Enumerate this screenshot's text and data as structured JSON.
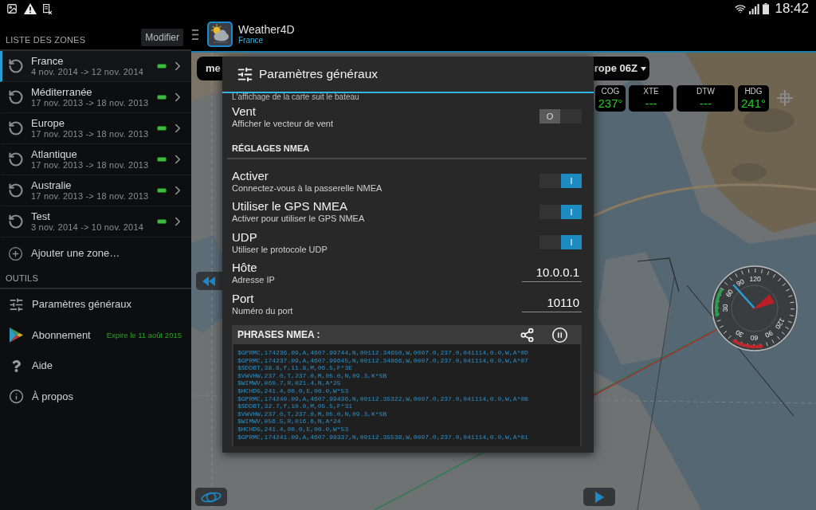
{
  "status_bar": {
    "time": "18:42"
  },
  "sidebar": {
    "zones_header": "LISTE DES ZONES",
    "edit_button": "Modifier",
    "zones": [
      {
        "name": "France",
        "dates": "4 nov. 2014 -> 12 nov. 2014",
        "selected": true
      },
      {
        "name": "Méditerranée",
        "dates": "17 nov. 2013 -> 18 nov. 2013",
        "selected": false
      },
      {
        "name": "Europe",
        "dates": "17 nov. 2013 -> 18 nov. 2013",
        "selected": false
      },
      {
        "name": "Atlantique",
        "dates": "17 nov. 2013 -> 18 nov. 2013",
        "selected": false
      },
      {
        "name": "Australie",
        "dates": "17 nov. 2013 -> 18 nov. 2013",
        "selected": false
      },
      {
        "name": "Test",
        "dates": "3 nov. 2014 -> 10 nov. 2014",
        "selected": false
      }
    ],
    "add_zone": "Ajouter une zone…",
    "tools_header": "OUTILS",
    "tools": [
      {
        "kind": "settings",
        "label": "Paramètres généraux"
      },
      {
        "kind": "store",
        "label": "Abonnement",
        "note": "Expire le 11 août 2015"
      },
      {
        "kind": "help",
        "label": "Aide"
      },
      {
        "kind": "info",
        "label": "À propos"
      }
    ]
  },
  "app_bar": {
    "title": "Weather4D",
    "subtitle": "France"
  },
  "map": {
    "model_dropdown": {
      "visible_start": "me",
      "visible_end": "rope 06Z"
    },
    "instruments": [
      {
        "label": "COG",
        "value": "237°"
      },
      {
        "label": "XTE",
        "value": "---"
      },
      {
        "label": "DTW",
        "value": "---"
      },
      {
        "label": "HDG",
        "value": "241°"
      }
    ],
    "wind_dial": {
      "upper_labels": [
        "30",
        "60",
        "90",
        "120"
      ],
      "lower_labels": [
        "30",
        "60",
        "90",
        "120"
      ]
    }
  },
  "dialog": {
    "title": "Paramètres généraux",
    "partial_line": "L'affichage de la carte suit le bateau",
    "settings": [
      {
        "kind": "switch",
        "title": "Vent",
        "subtitle": "Afficher le vecteur de vent",
        "on": false,
        "thumb_text": "O"
      }
    ],
    "nmea": {
      "title": "RÉGLAGES NMEA",
      "items": [
        {
          "kind": "switch",
          "title": "Activer",
          "subtitle": "Connectez-vous à la passerelle NMEA",
          "on": true,
          "thumb_text": "I"
        },
        {
          "kind": "switch",
          "title": "Utiliser le GPS NMEA",
          "subtitle": "Activer pour utiliser le GPS NMEA",
          "on": true,
          "thumb_text": "I"
        },
        {
          "kind": "switch",
          "title": "UDP",
          "subtitle": "Utiliser le protocole UDP",
          "on": true,
          "thumb_text": "I"
        },
        {
          "kind": "field",
          "title": "Hôte",
          "subtitle": "Adresse IP",
          "value": "10.0.0.1"
        },
        {
          "kind": "field",
          "title": "Port",
          "subtitle": "Numéro du port",
          "value": "10110"
        }
      ]
    },
    "log": {
      "title": "PHRASES NMEA :",
      "sentences": [
        "$GPRMC,174236.09,A,4607.99744,N,00112.34650,W,0007.0,237.0,041114,0.0,W,A*0D",
        "$GPRMC,174237.09,A,4607.99645,N,00112.34866,W,0007.0,237.0,041114,0.0,W,A*07",
        "$SDDBT,38.8,f,11.8,M,06.5,F*3E",
        "$VWVHW,237.0,T,237.0,M,05.0,N,09.3,K*5B",
        "$WIMWV,060.7,R,021.4,N,A*25",
        "$HCHDG,241.4,00.0,E,00.0,W*53",
        "$GPRMC,174240.09,A,4607.99436,N,00112.35322,W,0007.0,237.0,041114,0.0,W,A*0B",
        "$SDDBT,32.7,f,10.0,M,05.5,F*31",
        "$VWVHW,237.0,T,237.0,M,05.0,N,09.3,K*5B",
        "$WIMWV,056.5,R,016.6,N,A*24",
        "$HCHDG,241.4,00.0,E,00.0,W*53",
        "$GPRMC,174241.09,A,4607.99337,N,00112.35538,W,0007.0,237.0,041114,0.0,W,A*01"
      ]
    }
  }
}
